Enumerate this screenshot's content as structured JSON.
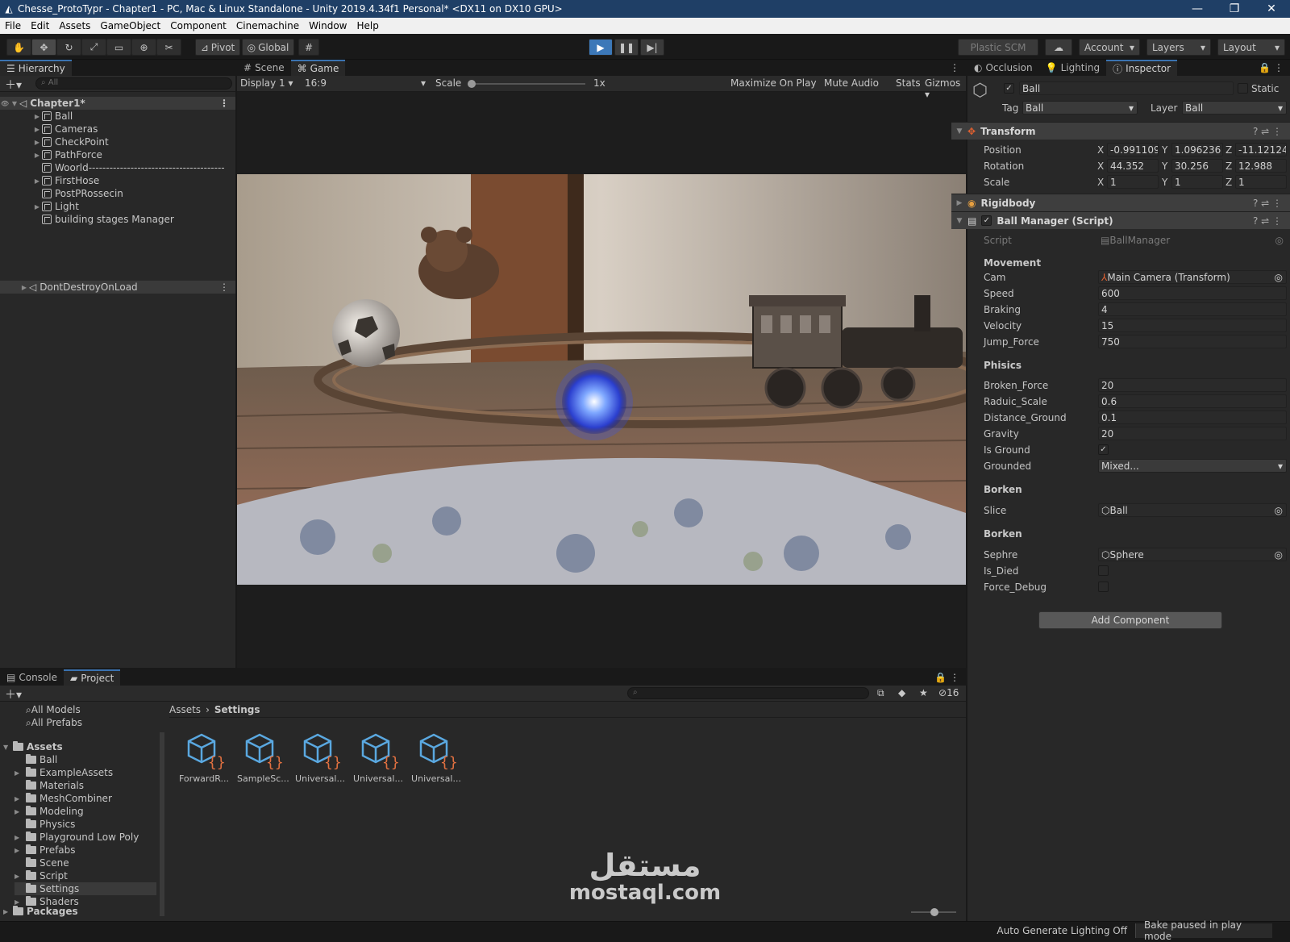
{
  "window": {
    "title": "Chesse_ProtoTypr - Chapter1 - PC, Mac & Linux Standalone - Unity 2019.4.34f1 Personal* <DX11 on DX10 GPU>",
    "minimize": "—",
    "maximize": "❐",
    "close": "✕"
  },
  "menu": [
    "File",
    "Edit",
    "Assets",
    "GameObject",
    "Component",
    "Cinemachine",
    "Window",
    "Help"
  ],
  "toolbar": {
    "pivot_label": "Pivot",
    "global_label": "Global",
    "plastic_label": "Plastic SCM",
    "account_label": "Account",
    "layers_label": "Layers",
    "layout_label": "Layout",
    "accent_color": "#3c78b8"
  },
  "hierarchy": {
    "tab_label": "Hierarchy",
    "search_placeholder": "All",
    "scene_name": "Chapter1*",
    "items": [
      {
        "label": "Ball",
        "expandable": true
      },
      {
        "label": "Cameras",
        "expandable": true
      },
      {
        "label": "CheckPoint",
        "expandable": true
      },
      {
        "label": "PathForce",
        "expandable": true
      },
      {
        "label": "Woorld---------------------------------------",
        "expandable": false
      },
      {
        "label": "FirstHose",
        "expandable": true
      },
      {
        "label": "PostPRossecin",
        "expandable": false
      },
      {
        "label": "Light",
        "expandable": true
      },
      {
        "label": "building stages Manager",
        "expandable": false
      }
    ],
    "dont_destroy": "DontDestroyOnLoad"
  },
  "game_view": {
    "tabs": [
      "Scene",
      "Game"
    ],
    "display": "Display 1",
    "aspect": "16:9",
    "scale_label": "Scale",
    "scale_value": "1x",
    "maximize_label": "Maximize On Play",
    "mute_label": "Mute Audio",
    "stats_label": "Stats",
    "gizmos_label": "Gizmos"
  },
  "inspector": {
    "tabs": [
      "Occlusion",
      "Lighting",
      "Inspector"
    ],
    "object_name": "Ball",
    "static_label": "Static",
    "tag_label": "Tag",
    "tag_value": "Ball",
    "layer_label": "Layer",
    "layer_value": "Ball",
    "transform": {
      "title": "Transform",
      "position_label": "Position",
      "rotation_label": "Rotation",
      "scale_label": "Scale",
      "axis_x": "X",
      "axis_y": "Y",
      "axis_z": "Z",
      "position": [
        "-0.991109",
        "1.096236",
        "-11.12124"
      ],
      "rotation": [
        "44.352",
        "30.256",
        "12.988"
      ],
      "scale": [
        "1",
        "1",
        "1"
      ]
    },
    "rigidbody_title": "Rigidbody",
    "script_component": {
      "title": "Ball Manager (Script)",
      "script_label": "Script",
      "script_value": "BallManager",
      "movement_header": "Movement",
      "cam_label": "Cam",
      "cam_value": "Main Camera (Transform)",
      "speed_label": "Speed",
      "speed_value": "600",
      "braking_label": "Braking",
      "braking_value": "4",
      "velocity_label": "Velocity",
      "velocity_value": "15",
      "jump_label": "Jump_Force",
      "jump_value": "750",
      "phisics_header": "Phisics",
      "broken_force_label": "Broken_Force",
      "broken_force_value": "20",
      "raduic_label": "Raduic_Scale",
      "raduic_value": "0.6",
      "distance_label": "Distance_Ground",
      "distance_value": "0.1",
      "gravity_label": "Gravity",
      "gravity_value": "20",
      "is_ground_label": "Is Ground",
      "is_ground_checked": "✓",
      "grounded_label": "Grounded",
      "grounded_value": "Mixed...",
      "borken_header_1": "Borken",
      "slice_label": "Slice",
      "slice_value": "Ball",
      "borken_header_2": "Borken",
      "sphere_label": "Sephre",
      "sphere_value": "Sphere",
      "is_died_label": "Is_Died",
      "force_debug_label": "Force_Debug"
    },
    "add_component": "Add Component"
  },
  "project": {
    "tabs": [
      "Console",
      "Project"
    ],
    "badge_count": "16",
    "favorites": [
      "All Models",
      "All Prefabs"
    ],
    "assets_root": "Assets",
    "folders": [
      {
        "label": "Ball",
        "expandable": false
      },
      {
        "label": "ExampleAssets",
        "expandable": true
      },
      {
        "label": "Materials",
        "expandable": false
      },
      {
        "label": "MeshCombiner",
        "expandable": true
      },
      {
        "label": "Modeling",
        "expandable": true
      },
      {
        "label": "Physics",
        "expandable": false
      },
      {
        "label": "Playground Low Poly",
        "expandable": true
      },
      {
        "label": "Prefabs",
        "expandable": true
      },
      {
        "label": "Scene",
        "expandable": false
      },
      {
        "label": "Script",
        "expandable": true
      },
      {
        "label": "Settings",
        "expandable": false
      },
      {
        "label": "Shaders",
        "expandable": true
      }
    ],
    "packages": "Packages",
    "breadcrumb_root": "Assets",
    "breadcrumb_current": "Settings",
    "files": [
      "ForwardR...",
      "SampleSc...",
      "Universal...",
      "Universal...",
      "Universal..."
    ]
  },
  "status": {
    "lighting": "Auto Generate Lighting Off",
    "bake": "Bake paused in play mode"
  },
  "watermark": {
    "arabic": "مستقل",
    "latin": "mostaql.com"
  }
}
